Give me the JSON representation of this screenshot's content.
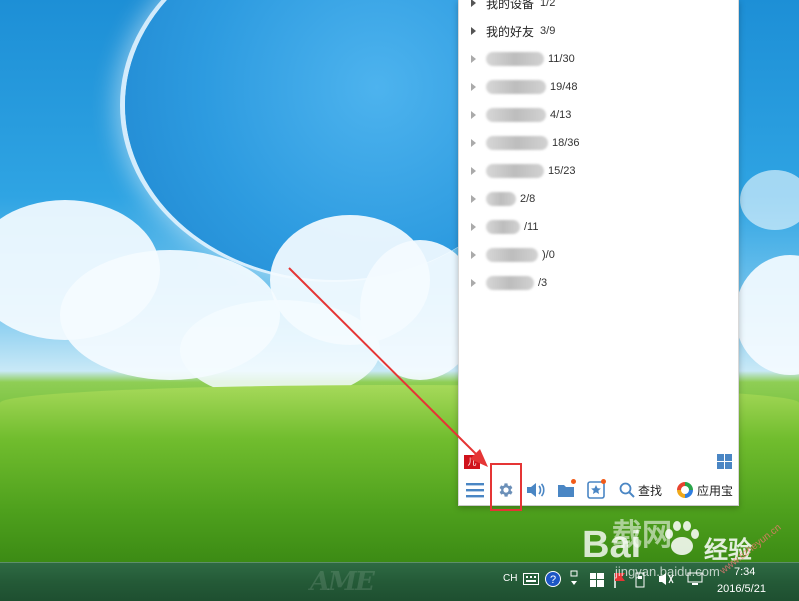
{
  "qq_panel": {
    "groups": [
      {
        "name": "我的设备",
        "count": "1/2",
        "name_visible": true
      },
      {
        "name": "我的好友",
        "count": "3/9",
        "name_visible": true
      },
      {
        "name": "",
        "count": "11/30",
        "name_visible": false
      },
      {
        "name": "",
        "count": "19/48",
        "name_visible": false
      },
      {
        "name": "",
        "count": "4/13",
        "name_visible": false
      },
      {
        "name": "",
        "count": "18/36",
        "name_visible": false
      },
      {
        "name": "",
        "count": "15/23",
        "name_visible": false
      },
      {
        "name": "",
        "count": "2/8",
        "name_visible": false
      },
      {
        "name": "",
        "count": "/11",
        "name_visible": false
      },
      {
        "name": "",
        "count": ")/0",
        "name_visible": false
      },
      {
        "name": "",
        "count": "/3",
        "name_visible": false
      }
    ],
    "app_badge": "儿",
    "toolbar": {
      "menu_icon": "menu-icon",
      "settings_icon": "gear-icon",
      "volume_icon": "speaker-icon",
      "folder_icon": "folder-icon",
      "favorites_icon": "star-bookmark-icon",
      "search_label": "查找",
      "app_store_label": "应用宝"
    }
  },
  "taskbar": {
    "input_lang": "CH",
    "time": "7:34",
    "date": "2016/5/21"
  },
  "watermark": {
    "brand_left": "Bai",
    "brand_right": "经验",
    "url": "jingyan.baidu.com",
    "logo_text": "载网",
    "site": "www.tizheyun.cn"
  },
  "colors": {
    "accent_blue": "#4a86c4",
    "highlight_red": "#e53535",
    "notify_orange": "#f25a18",
    "taskbar_green": "#245a37"
  }
}
